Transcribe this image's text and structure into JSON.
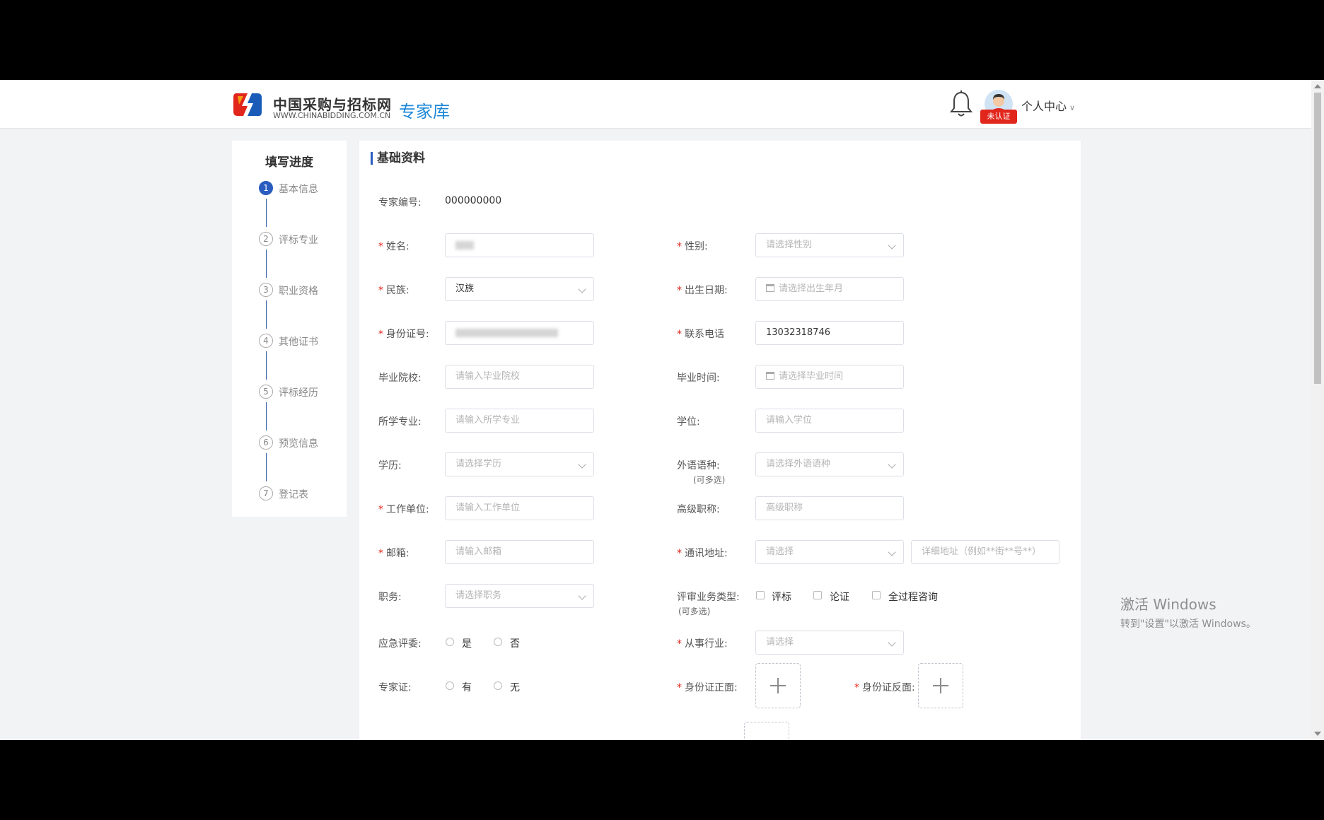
{
  "header": {
    "logo_name": "中国采购与招标网",
    "logo_url": "WWW.CHINABIDDING.COM.CN",
    "logo_sub": "专家库",
    "badge": "未认证",
    "user_center": "个人中心"
  },
  "sidebar": {
    "title": "填写进度",
    "steps": [
      {
        "num": "1",
        "label": "基本信息"
      },
      {
        "num": "2",
        "label": "评标专业"
      },
      {
        "num": "3",
        "label": "职业资格"
      },
      {
        "num": "4",
        "label": "其他证书"
      },
      {
        "num": "5",
        "label": "评标经历"
      },
      {
        "num": "6",
        "label": "预览信息"
      },
      {
        "num": "7",
        "label": "登记表"
      }
    ]
  },
  "form": {
    "section_title": "基础资料",
    "expert_no_label": "专家编号:",
    "expert_no_value": "000000000",
    "name_label": "姓名:",
    "gender_label": "性别:",
    "gender_placeholder": "请选择性别",
    "ethnicity_label": "民族:",
    "ethnicity_value": "汉族",
    "birth_label": "出生日期:",
    "birth_placeholder": "请选择出生年月",
    "idno_label": "身份证号:",
    "phone_label": "联系电话",
    "phone_value": "13032318746",
    "school_label": "毕业院校:",
    "school_placeholder": "请输入毕业院校",
    "grad_time_label": "毕业时间:",
    "grad_time_placeholder": "请选择毕业时间",
    "major_label": "所学专业:",
    "major_placeholder": "请输入所学专业",
    "degree_label": "学位:",
    "degree_placeholder": "请输入学位",
    "education_label": "学历:",
    "education_placeholder": "请选择学历",
    "language_label": "外语语种:",
    "language_note": "(可多选)",
    "language_placeholder": "请选择外语语种",
    "employer_label": "工作单位:",
    "employer_placeholder": "请输入工作单位",
    "title_label": "高级职称:",
    "title_placeholder": "高级职称",
    "email_label": "邮箱:",
    "email_placeholder": "请输入邮箱",
    "address_label": "通讯地址:",
    "address_placeholder": "请选择",
    "address_detail_placeholder": "详细地址（例如**街**号**）",
    "position_label": "职务:",
    "position_placeholder": "请选择职务",
    "review_type_label": "评审业务类型:",
    "review_type_note": "(可多选)",
    "review_type_options": [
      "评标",
      "论证",
      "全过程咨询"
    ],
    "emergency_label": "应急评委:",
    "emergency_options": [
      "是",
      "否"
    ],
    "industry_label": "从事行业:",
    "industry_placeholder": "请选择",
    "expert_cert_label": "专家证:",
    "expert_cert_options": [
      "有",
      "无"
    ],
    "id_front_label": "身份证正面:",
    "id_back_label": "身份证反面:"
  },
  "watermark": {
    "title": "激活 Windows",
    "sub": "转到\"设置\"以激活 Windows。"
  },
  "colors": {
    "accent": "#2a5cbf",
    "required": "#e1261c",
    "logo_blue": "#1e88d8"
  }
}
